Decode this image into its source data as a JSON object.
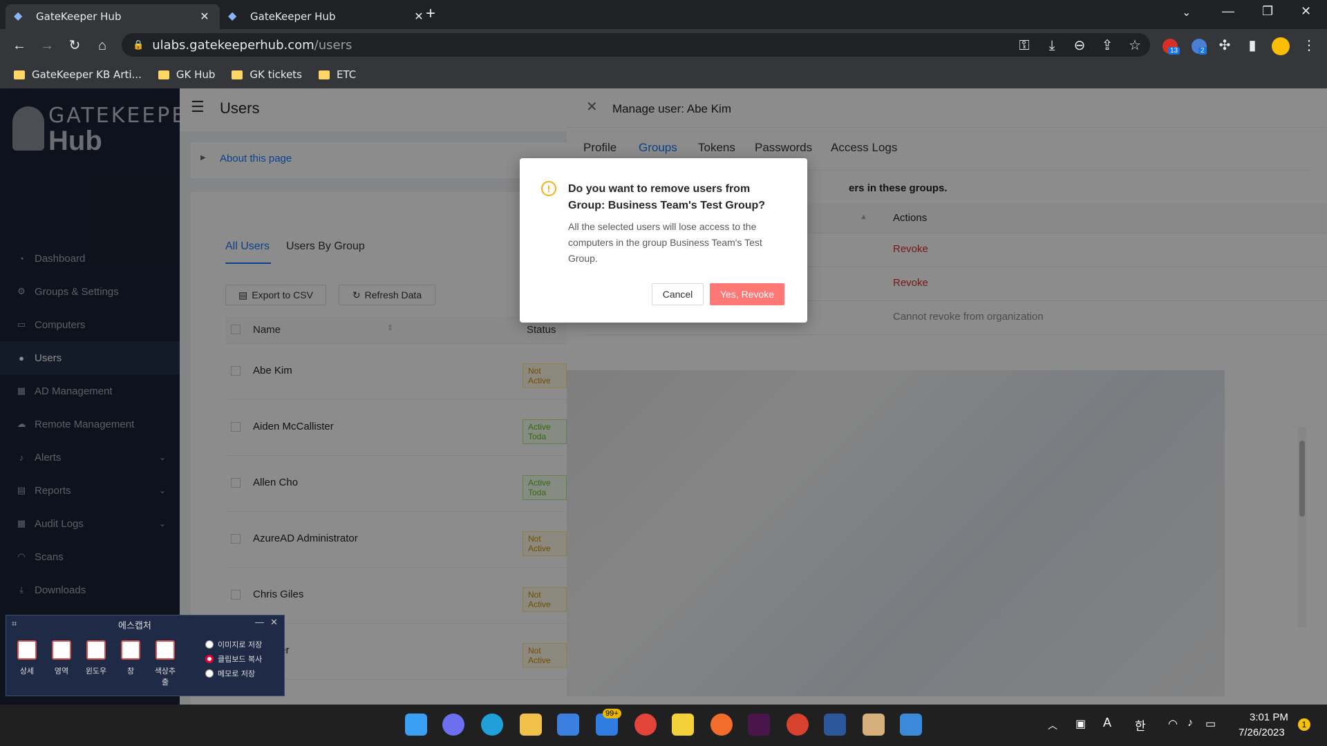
{
  "browser": {
    "tabs": [
      {
        "title": "GateKeeper Hub",
        "active": true
      },
      {
        "title": "GateKeeper Hub",
        "active": false
      }
    ],
    "url_host": "ulabs.gatekeeperhub.com",
    "url_path": "/users",
    "ext_badges": [
      "13",
      "2"
    ],
    "bookmarks": [
      "GateKeeper KB Arti...",
      "GK Hub",
      "GK tickets",
      "ETC"
    ]
  },
  "app": {
    "logo_top": "GATEKEEPER",
    "logo_bottom": "Hub",
    "page_title": "Users",
    "about": "About this page",
    "nav": [
      {
        "label": "Dashboard",
        "icon": "dashboard-icon"
      },
      {
        "label": "Groups & Settings",
        "icon": "settings-icon"
      },
      {
        "label": "Computers",
        "icon": "computer-icon"
      },
      {
        "label": "Users",
        "icon": "users-icon",
        "selected": true
      },
      {
        "label": "AD Management",
        "icon": "ad-icon"
      },
      {
        "label": "Remote Management",
        "icon": "remote-icon"
      },
      {
        "label": "Alerts",
        "icon": "bell-icon",
        "expand": true
      },
      {
        "label": "Reports",
        "icon": "report-icon",
        "expand": true
      },
      {
        "label": "Audit Logs",
        "icon": "table-icon",
        "expand": true
      },
      {
        "label": "Scans",
        "icon": "wifi-icon"
      },
      {
        "label": "Downloads",
        "icon": "download-icon"
      }
    ],
    "tabs": [
      "All Users",
      "Users By Group"
    ],
    "export_btn": "Export to CSV",
    "refresh_btn": "Refresh Data",
    "col_name": "Name",
    "col_status": "Status",
    "users": [
      {
        "name": "Abe Kim",
        "status": "Not Active"
      },
      {
        "name": "Aiden McCallister",
        "status": "Active Toda"
      },
      {
        "name": "Allen Cho",
        "status": "Active Toda"
      },
      {
        "name": "AzureAD Administrator",
        "status": "Not Active"
      },
      {
        "name": "Chris Giles",
        "status": "Not Active"
      },
      {
        "name": "on User",
        "status": "Not Active"
      }
    ]
  },
  "drawer": {
    "title": "Manage user: Abe Kim",
    "tabs": [
      "Profile",
      "Groups",
      "Tokens",
      "Passwords",
      "Access Logs"
    ],
    "active_tab": "Groups",
    "hint": "ers in these groups.",
    "col_actions": "Actions",
    "actions": [
      "Revoke",
      "Revoke",
      "Cannot revoke from organization"
    ]
  },
  "modal": {
    "title": "Do you want to remove users from Group: Business Team's Test Group?",
    "body": "All the selected users will lose access to the computers in the group Business Team's Test Group.",
    "cancel": "Cancel",
    "confirm": "Yes, Revoke",
    "confirm_color": "#ff7875"
  },
  "capture": {
    "title": "에스캡처",
    "tools": [
      "상세",
      "영역",
      "윈도우",
      "창",
      "색상추출"
    ],
    "options": [
      "이미지로 저장",
      "클립보드 복사",
      "메모로 저장"
    ],
    "selected_option": "클립보드 복사"
  },
  "taskbar": {
    "mail_badge": "99+",
    "ime": "한",
    "time": "3:01 PM",
    "date": "7/26/2023",
    "notif": "1"
  }
}
